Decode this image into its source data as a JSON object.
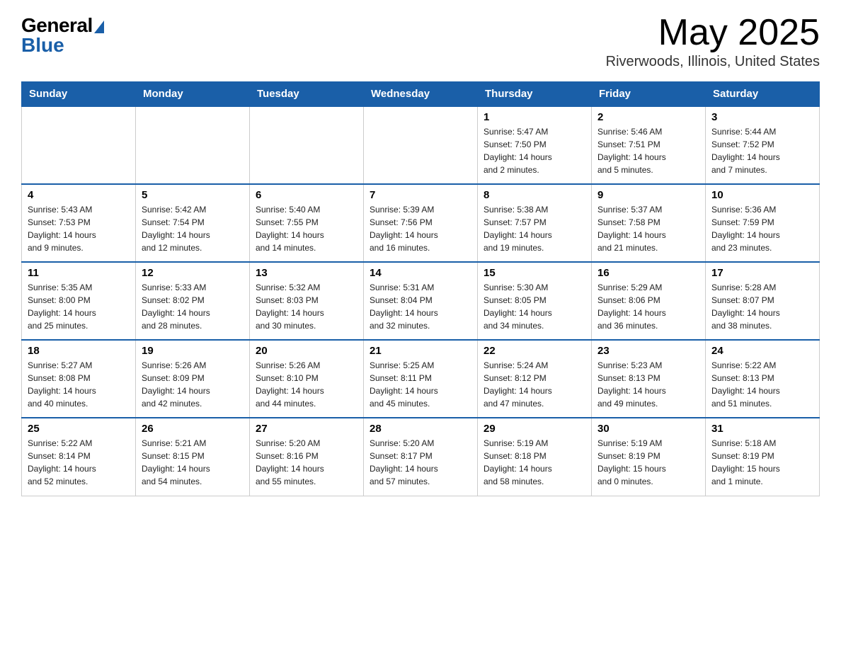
{
  "header": {
    "logo_general": "General",
    "logo_blue": "Blue",
    "month_year": "May 2025",
    "location": "Riverwoods, Illinois, United States"
  },
  "days_of_week": [
    "Sunday",
    "Monday",
    "Tuesday",
    "Wednesday",
    "Thursday",
    "Friday",
    "Saturday"
  ],
  "weeks": [
    {
      "days": [
        {
          "number": "",
          "info": ""
        },
        {
          "number": "",
          "info": ""
        },
        {
          "number": "",
          "info": ""
        },
        {
          "number": "",
          "info": ""
        },
        {
          "number": "1",
          "info": "Sunrise: 5:47 AM\nSunset: 7:50 PM\nDaylight: 14 hours\nand 2 minutes."
        },
        {
          "number": "2",
          "info": "Sunrise: 5:46 AM\nSunset: 7:51 PM\nDaylight: 14 hours\nand 5 minutes."
        },
        {
          "number": "3",
          "info": "Sunrise: 5:44 AM\nSunset: 7:52 PM\nDaylight: 14 hours\nand 7 minutes."
        }
      ]
    },
    {
      "days": [
        {
          "number": "4",
          "info": "Sunrise: 5:43 AM\nSunset: 7:53 PM\nDaylight: 14 hours\nand 9 minutes."
        },
        {
          "number": "5",
          "info": "Sunrise: 5:42 AM\nSunset: 7:54 PM\nDaylight: 14 hours\nand 12 minutes."
        },
        {
          "number": "6",
          "info": "Sunrise: 5:40 AM\nSunset: 7:55 PM\nDaylight: 14 hours\nand 14 minutes."
        },
        {
          "number": "7",
          "info": "Sunrise: 5:39 AM\nSunset: 7:56 PM\nDaylight: 14 hours\nand 16 minutes."
        },
        {
          "number": "8",
          "info": "Sunrise: 5:38 AM\nSunset: 7:57 PM\nDaylight: 14 hours\nand 19 minutes."
        },
        {
          "number": "9",
          "info": "Sunrise: 5:37 AM\nSunset: 7:58 PM\nDaylight: 14 hours\nand 21 minutes."
        },
        {
          "number": "10",
          "info": "Sunrise: 5:36 AM\nSunset: 7:59 PM\nDaylight: 14 hours\nand 23 minutes."
        }
      ]
    },
    {
      "days": [
        {
          "number": "11",
          "info": "Sunrise: 5:35 AM\nSunset: 8:00 PM\nDaylight: 14 hours\nand 25 minutes."
        },
        {
          "number": "12",
          "info": "Sunrise: 5:33 AM\nSunset: 8:02 PM\nDaylight: 14 hours\nand 28 minutes."
        },
        {
          "number": "13",
          "info": "Sunrise: 5:32 AM\nSunset: 8:03 PM\nDaylight: 14 hours\nand 30 minutes."
        },
        {
          "number": "14",
          "info": "Sunrise: 5:31 AM\nSunset: 8:04 PM\nDaylight: 14 hours\nand 32 minutes."
        },
        {
          "number": "15",
          "info": "Sunrise: 5:30 AM\nSunset: 8:05 PM\nDaylight: 14 hours\nand 34 minutes."
        },
        {
          "number": "16",
          "info": "Sunrise: 5:29 AM\nSunset: 8:06 PM\nDaylight: 14 hours\nand 36 minutes."
        },
        {
          "number": "17",
          "info": "Sunrise: 5:28 AM\nSunset: 8:07 PM\nDaylight: 14 hours\nand 38 minutes."
        }
      ]
    },
    {
      "days": [
        {
          "number": "18",
          "info": "Sunrise: 5:27 AM\nSunset: 8:08 PM\nDaylight: 14 hours\nand 40 minutes."
        },
        {
          "number": "19",
          "info": "Sunrise: 5:26 AM\nSunset: 8:09 PM\nDaylight: 14 hours\nand 42 minutes."
        },
        {
          "number": "20",
          "info": "Sunrise: 5:26 AM\nSunset: 8:10 PM\nDaylight: 14 hours\nand 44 minutes."
        },
        {
          "number": "21",
          "info": "Sunrise: 5:25 AM\nSunset: 8:11 PM\nDaylight: 14 hours\nand 45 minutes."
        },
        {
          "number": "22",
          "info": "Sunrise: 5:24 AM\nSunset: 8:12 PM\nDaylight: 14 hours\nand 47 minutes."
        },
        {
          "number": "23",
          "info": "Sunrise: 5:23 AM\nSunset: 8:13 PM\nDaylight: 14 hours\nand 49 minutes."
        },
        {
          "number": "24",
          "info": "Sunrise: 5:22 AM\nSunset: 8:13 PM\nDaylight: 14 hours\nand 51 minutes."
        }
      ]
    },
    {
      "days": [
        {
          "number": "25",
          "info": "Sunrise: 5:22 AM\nSunset: 8:14 PM\nDaylight: 14 hours\nand 52 minutes."
        },
        {
          "number": "26",
          "info": "Sunrise: 5:21 AM\nSunset: 8:15 PM\nDaylight: 14 hours\nand 54 minutes."
        },
        {
          "number": "27",
          "info": "Sunrise: 5:20 AM\nSunset: 8:16 PM\nDaylight: 14 hours\nand 55 minutes."
        },
        {
          "number": "28",
          "info": "Sunrise: 5:20 AM\nSunset: 8:17 PM\nDaylight: 14 hours\nand 57 minutes."
        },
        {
          "number": "29",
          "info": "Sunrise: 5:19 AM\nSunset: 8:18 PM\nDaylight: 14 hours\nand 58 minutes."
        },
        {
          "number": "30",
          "info": "Sunrise: 5:19 AM\nSunset: 8:19 PM\nDaylight: 15 hours\nand 0 minutes."
        },
        {
          "number": "31",
          "info": "Sunrise: 5:18 AM\nSunset: 8:19 PM\nDaylight: 15 hours\nand 1 minute."
        }
      ]
    }
  ]
}
